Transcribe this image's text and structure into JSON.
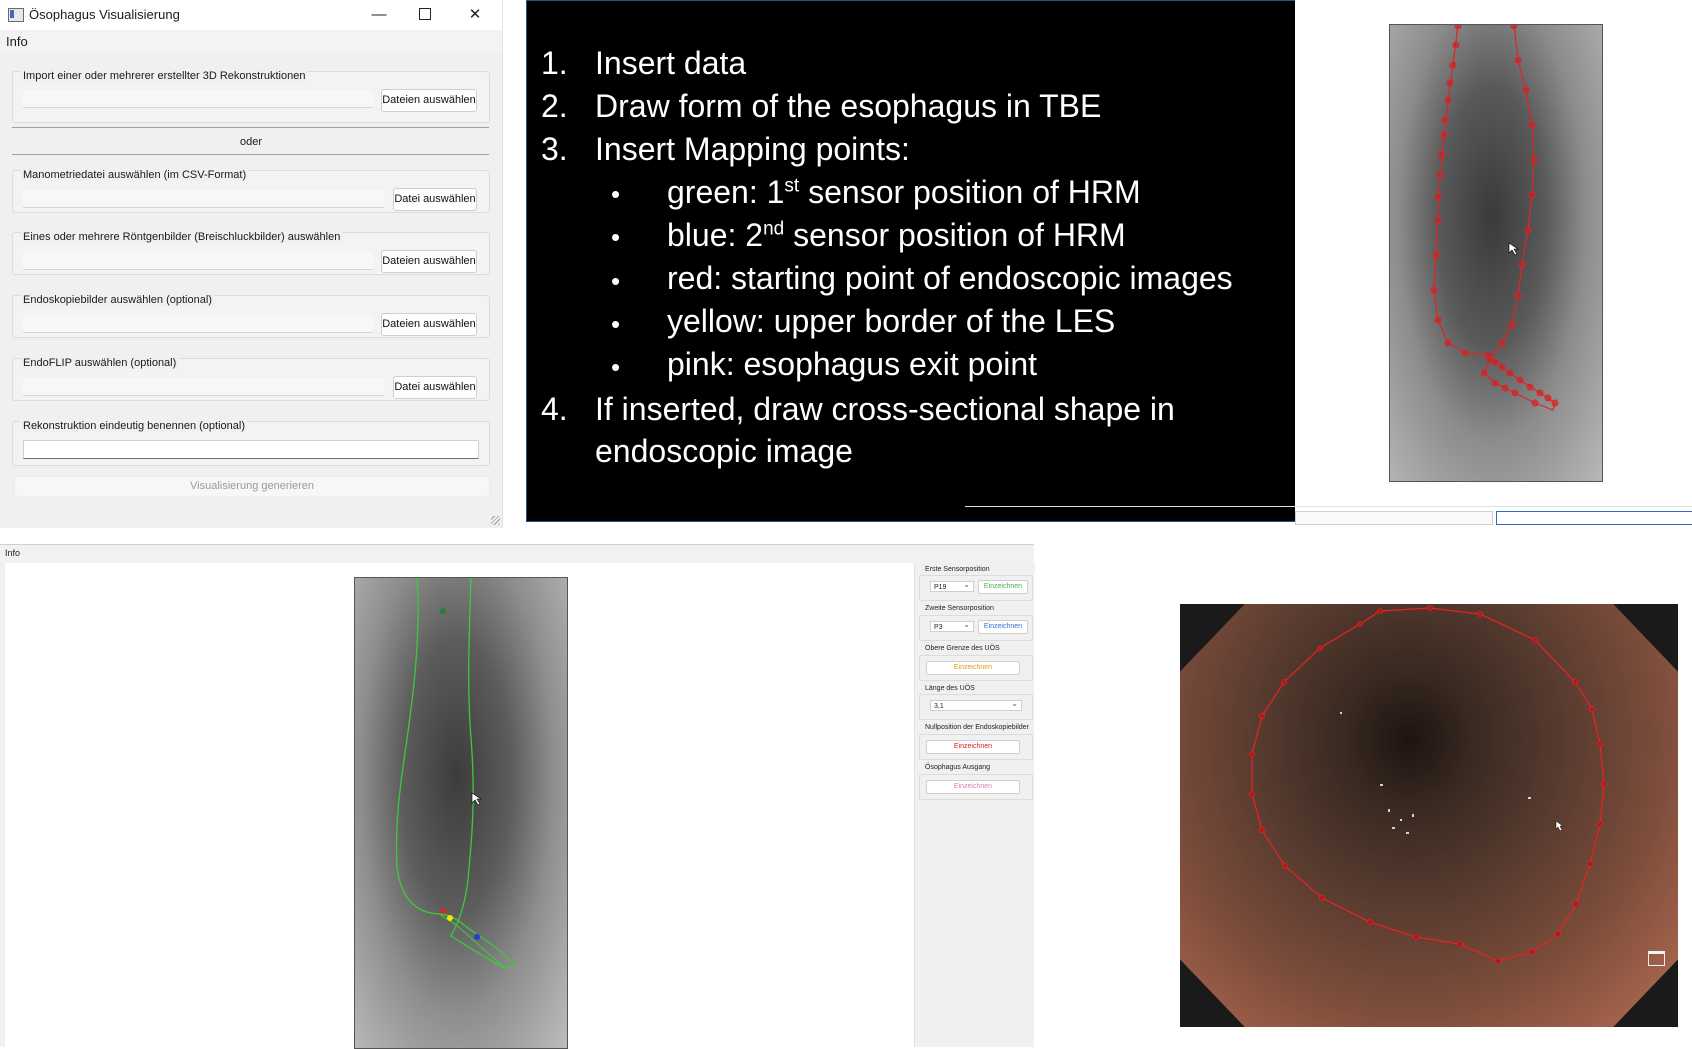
{
  "window1": {
    "title": "Ösophagus Visualisierung",
    "controls": {
      "minimize": "—",
      "close": "✕"
    },
    "menu": [
      "Info"
    ],
    "groups": [
      {
        "label": "Import einer oder mehrerer erstellter 3D Rekonstruktionen",
        "button": "Dateien auswählen"
      },
      {
        "label": "Manometriedatei auswählen (im CSV-Format)",
        "button": "Datei auswählen"
      },
      {
        "label": "Eines oder mehrere Röntgenbilder (Breischluckbilder) auswählen",
        "button": "Dateien auswählen"
      },
      {
        "label": "Endoskopiebilder auswählen (optional)",
        "button": "Dateien auswählen"
      },
      {
        "label": "EndoFLIP auswählen (optional)",
        "button": "Datei auswählen"
      },
      {
        "label": "Rekonstruktion eindeutig benennen (optional)",
        "button": ""
      }
    ],
    "separator_text": "oder",
    "generate_button": "Visualisierung generieren"
  },
  "instructions": {
    "steps": [
      {
        "num": "1.",
        "text": "Insert data"
      },
      {
        "num": "2.",
        "text": "Draw form of the esophagus in TBE"
      },
      {
        "num": "3.",
        "text": "Insert Mapping points:"
      },
      {
        "num": "4.",
        "text": "If inserted, draw cross-sectional shape in",
        "text2": "endoscopic image"
      }
    ],
    "bullets": [
      {
        "marker": "•",
        "pre": "green: 1",
        "sup": "st",
        "post": " sensor position of HRM"
      },
      {
        "marker": "•",
        "pre": "blue: 2",
        "sup": "nd",
        "post": " sensor position of HRM"
      },
      {
        "marker": "•",
        "text": "red: starting point of endoscopic images"
      },
      {
        "marker": "•",
        "text": "yellow: upper border of the LES"
      },
      {
        "marker": "•",
        "text": "pink: esophagus exit point"
      }
    ]
  },
  "window2": {
    "menu": "Info",
    "sidebar": [
      {
        "label": "Erste Sensorposition",
        "combo": "P19",
        "button": "Einzeichnen",
        "button_color": "#4caf50"
      },
      {
        "label": "Zweite Sensorposition",
        "combo": "P3",
        "button": "Einzeichnen",
        "button_color": "#2f6fd0"
      },
      {
        "label": "Obere Grenze des UÖS",
        "button": "Einzeichnen",
        "button_color": "#d4a017"
      },
      {
        "label": "Länge des UÖS",
        "spin": "3,1"
      },
      {
        "label": "Nullposition der Endoskopiebilder",
        "button": "Einzeichnen",
        "button_color": "#d02020"
      },
      {
        "label": "Ösophagus Ausgang",
        "button": "Einzeichnen",
        "button_color": "#e07ab0"
      }
    ]
  }
}
